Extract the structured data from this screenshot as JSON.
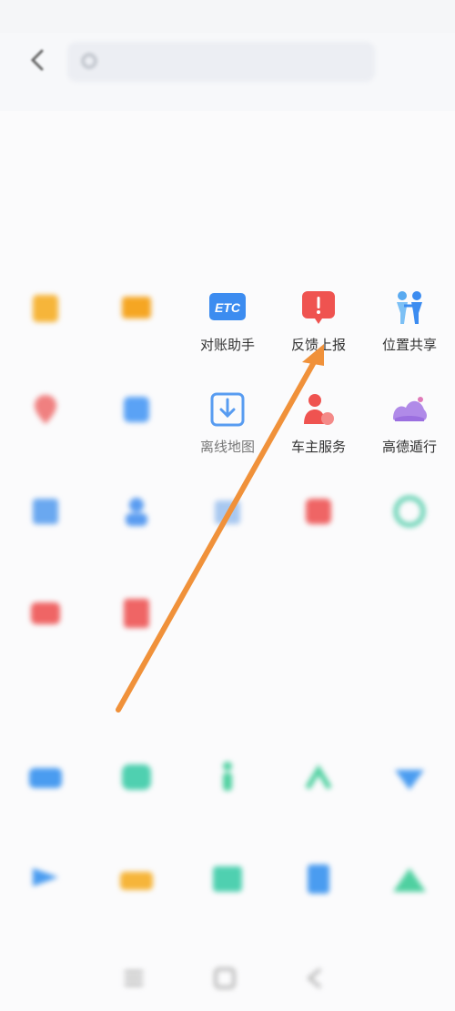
{
  "status_bar": {
    "left": "",
    "right": ""
  },
  "search": {
    "placeholder": ""
  },
  "page_title": "",
  "sections": {
    "first": "",
    "second": ""
  },
  "tools_rows": [
    [
      {
        "label": "",
        "icon": "wallet-icon",
        "color": "#f6b53a"
      },
      {
        "label": "",
        "icon": "card-icon",
        "color": "#f5a623"
      },
      {
        "label": "对账助手",
        "icon": "etc-icon",
        "color": "#3c8cf0"
      },
      {
        "label": "反馈上报",
        "icon": "feedback-icon",
        "color": "#ef5350"
      },
      {
        "label": "位置共享",
        "icon": "location-share-icon",
        "color": "#4aa3f0"
      }
    ],
    [
      {
        "label": "",
        "icon": "pin-icon",
        "color": "#f08080"
      },
      {
        "label": "",
        "icon": "star-icon",
        "color": "#5aa2f5"
      },
      {
        "label": "离线地图",
        "icon": "offline-map-icon",
        "color": "#3c8cf0"
      },
      {
        "label": "车主服务",
        "icon": "car-owner-icon",
        "color": "#ef5350"
      },
      {
        "label": "高德遁行",
        "icon": "cloud-car-icon",
        "color": "#a37be8"
      }
    ],
    [
      {
        "label": "",
        "icon": "chart-icon",
        "color": "#6aa8f0"
      },
      {
        "label": "",
        "icon": "user-icon",
        "color": "#5a9cf0"
      },
      {
        "label": "",
        "icon": "note-icon",
        "color": "#a8c8f0"
      },
      {
        "label": "",
        "icon": "calendar-icon",
        "color": "#ef6565"
      },
      {
        "label": "",
        "icon": "circle-icon",
        "color": "#5fd0b0"
      }
    ],
    [
      {
        "label": "",
        "icon": "video-icon",
        "color": "#ef6565"
      },
      {
        "label": "",
        "icon": "doc-icon",
        "color": "#ef6565"
      }
    ]
  ],
  "travel_rows": [
    [
      {
        "label": "",
        "icon": "bus-icon",
        "color": "#4a9cf0"
      },
      {
        "label": "",
        "icon": "screen-icon",
        "color": "#4fd0b0"
      },
      {
        "label": "",
        "icon": "walk-icon",
        "color": "#4fd0a0"
      },
      {
        "label": "",
        "icon": "bike-icon",
        "color": "#4fd0a0"
      },
      {
        "label": "",
        "icon": "diamond-icon",
        "color": "#4a9cf0"
      }
    ],
    [
      {
        "label": "",
        "icon": "flag-icon",
        "color": "#4a9cf0"
      },
      {
        "label": "",
        "icon": "ticket-icon",
        "color": "#f6b53a"
      },
      {
        "label": "",
        "icon": "image-icon",
        "color": "#4fd0b0"
      },
      {
        "label": "",
        "icon": "list-icon",
        "color": "#4a9cf0"
      },
      {
        "label": "",
        "icon": "mountain-icon",
        "color": "#4fd0a0"
      }
    ]
  ]
}
